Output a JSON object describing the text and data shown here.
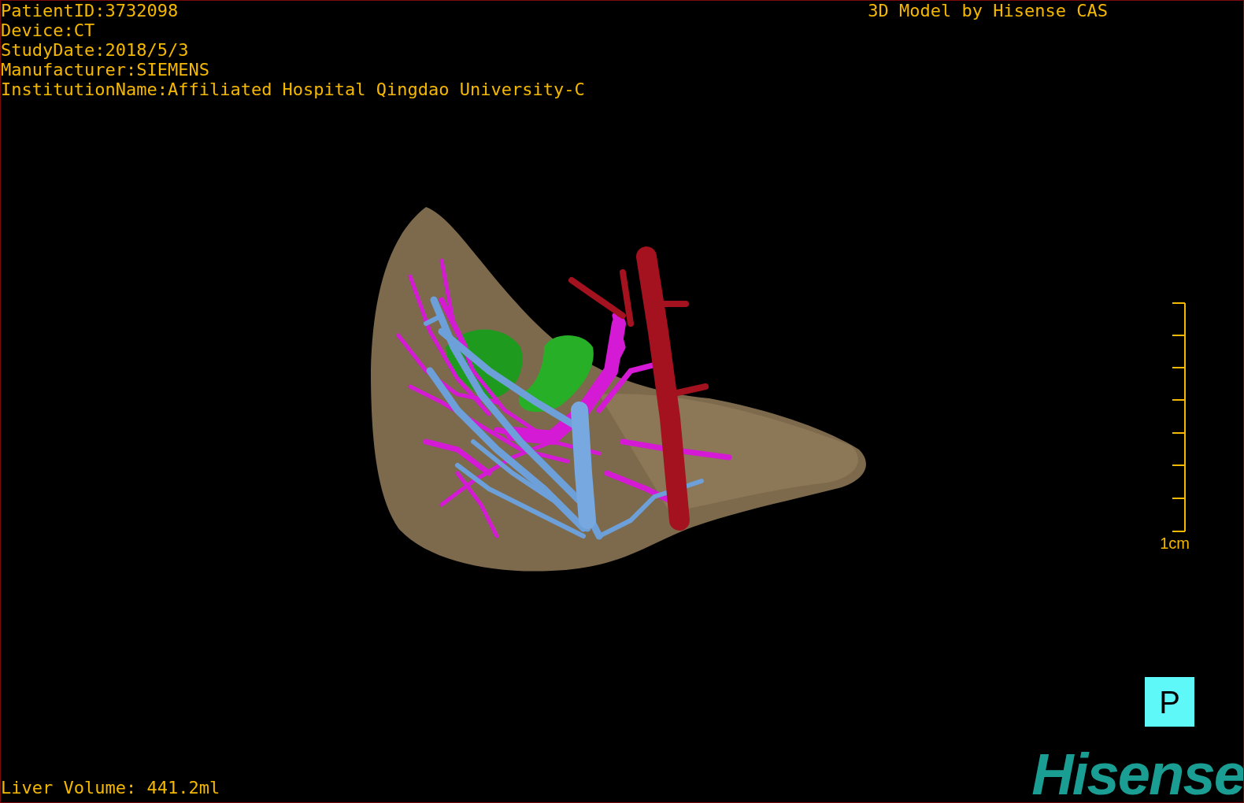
{
  "study_info": [
    "PatientID:3732098",
    "Device:CT",
    "StudyDate:2018/5/3",
    "Manufacturer:SIEMENS",
    "InstitutionName:Affiliated Hospital Qingdao University-C"
  ],
  "title": "3D Model by Hisense CAS",
  "scale_bar": {
    "label": "1cm"
  },
  "orientation_marker": {
    "label": "P"
  },
  "liver_volume": "Liver Volume: 441.2ml",
  "logo": "Hisense"
}
